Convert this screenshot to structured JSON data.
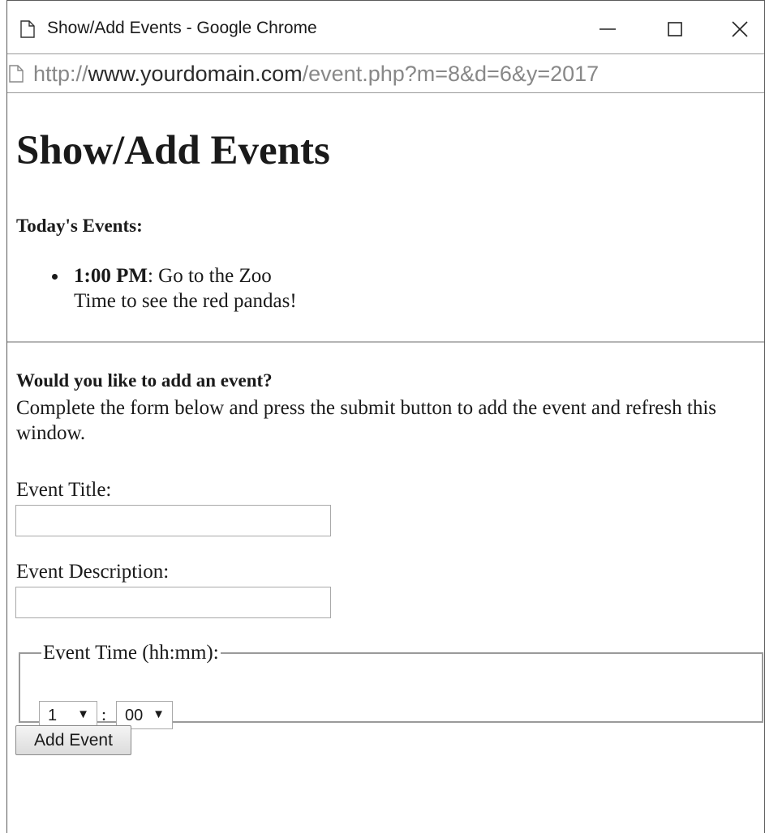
{
  "window": {
    "title": "Show/Add Events - Google Chrome",
    "controls": {
      "minimize": "minimize-icon",
      "maximize": "maximize-icon",
      "close": "close-icon"
    }
  },
  "address_bar": {
    "url_scheme": "http://",
    "url_host": "www.yourdomain.com",
    "url_path": "/event.php?m=8&d=6&y=2017"
  },
  "page": {
    "title": "Show/Add Events",
    "today_heading": "Today's Events:",
    "events": [
      {
        "time": "1:00 PM",
        "title": ": Go to the Zoo",
        "description": "Time to see the red pandas!"
      }
    ],
    "add_prompt": "Would you like to add an event?",
    "instructions": "Complete the form below and press the submit button to add the event and refresh this window."
  },
  "form": {
    "event_title_label": "Event Title:",
    "event_title_value": "",
    "event_description_label": "Event Description:",
    "event_description_value": "",
    "event_time_legend": "Event Time (hh:mm):",
    "hour_selected": "1",
    "time_separator": ":",
    "minute_selected": "00",
    "submit_label": "Add Event"
  },
  "colors": {
    "text": "#1a1a1a",
    "url_dim": "#888888",
    "divider": "#b5b5b5",
    "border": "#a9a9a9"
  }
}
